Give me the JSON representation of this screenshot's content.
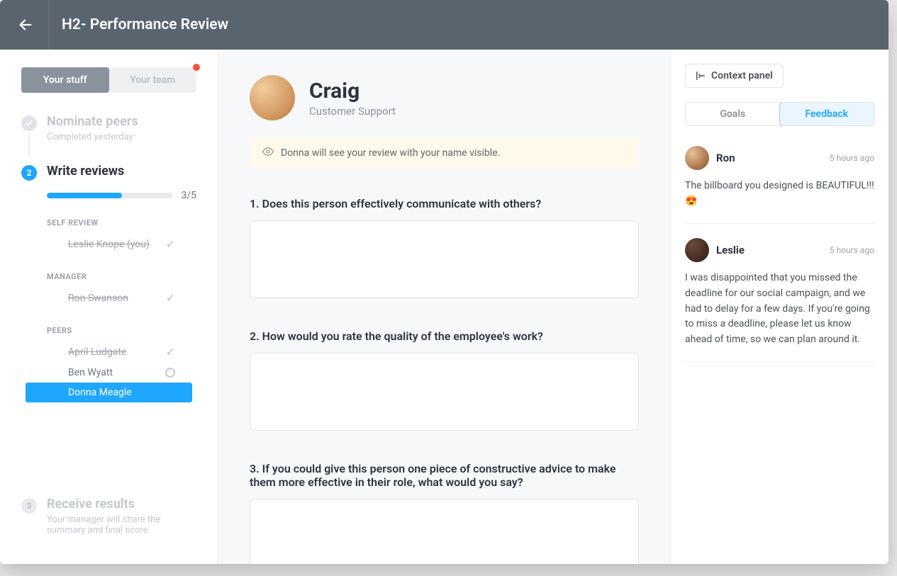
{
  "header": {
    "title": "H2- Performance Review"
  },
  "sidebar": {
    "tabs": {
      "your_stuff": "Your stuff",
      "your_team": "Your team"
    },
    "step1": {
      "title": "Nominate peers",
      "subtitle": "Completed yesterday"
    },
    "step2": {
      "number": "2",
      "title": "Write reviews",
      "progress_text": "3/5",
      "progress_pct": 60,
      "sections": {
        "self_label": "SELF REVIEW",
        "self_person": "Leslie Knope (you)",
        "manager_label": "MANAGER",
        "manager_person": "Ron Swanson",
        "peers_label": "PEERS",
        "peers": [
          {
            "name": "April Ludgate",
            "done": true,
            "selected": false
          },
          {
            "name": "Ben Wyatt",
            "done": false,
            "selected": false
          },
          {
            "name": "Donna Meagle",
            "done": false,
            "selected": true
          }
        ]
      }
    },
    "step3": {
      "number": "3",
      "title": "Receive results",
      "subtitle": "Your manager will share the summary and final score."
    }
  },
  "review": {
    "name": "Craig",
    "role": "Customer Support",
    "notice": "Donna will see your review with your name visible.",
    "questions": [
      "1. Does this person effectively communicate with others?",
      "2. How would you rate the quality of the employee's work?",
      "3. If you could give this person one piece of constructive advice to make them more effective in their role, what would you say?"
    ]
  },
  "context": {
    "button_label": "Context panel",
    "tabs": {
      "goals": "Goals",
      "feedback": "Feedback"
    },
    "feedback": [
      {
        "author": "Ron",
        "time": "5 hours ago",
        "body": "The billboard you designed is BEAUTIFUL!!! 😍",
        "avatar_class": "ron"
      },
      {
        "author": "Leslie",
        "time": "5 hours ago",
        "body": "I was  disappointed that you missed the deadline for our social campaign, and we had to delay for a few days. If you're going to miss a deadline, please let us know ahead of time, so we can plan around it.",
        "avatar_class": "leslie"
      }
    ]
  }
}
